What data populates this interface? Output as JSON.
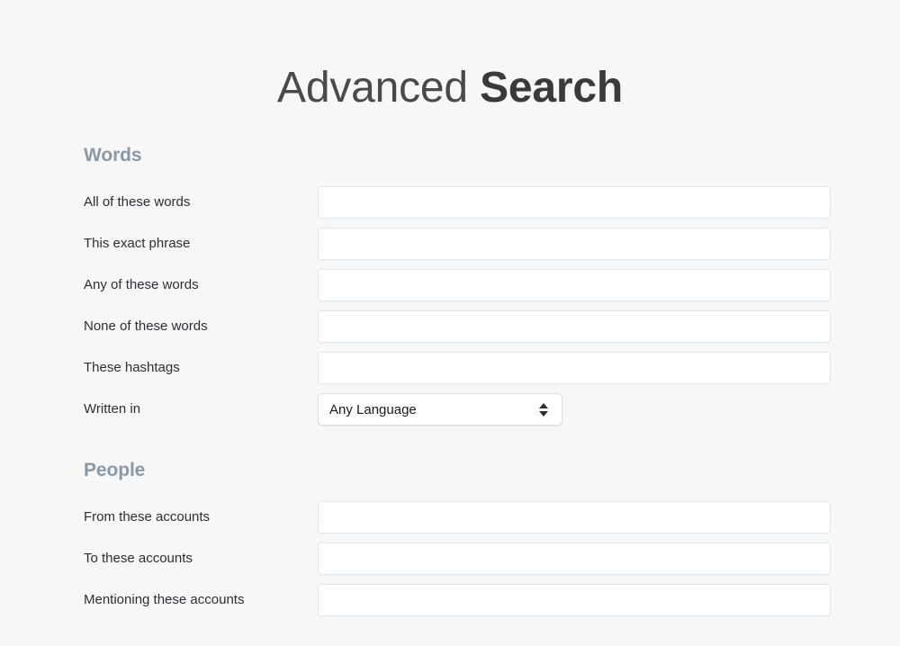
{
  "title": {
    "light": "Advanced ",
    "bold": "Search"
  },
  "sections": [
    {
      "id": "words",
      "header": "Words",
      "fields": [
        {
          "id": "all-of-these-words",
          "label": "All of these words",
          "type": "text",
          "value": "",
          "placeholder": ""
        },
        {
          "id": "this-exact-phrase",
          "label": "This exact phrase",
          "type": "text",
          "value": "",
          "placeholder": ""
        },
        {
          "id": "any-of-these-words",
          "label": "Any of these words",
          "type": "text",
          "value": "",
          "placeholder": ""
        },
        {
          "id": "none-of-these-words",
          "label": "None of these words",
          "type": "text",
          "value": "",
          "placeholder": ""
        },
        {
          "id": "these-hashtags",
          "label": "These hashtags",
          "type": "text",
          "value": "",
          "placeholder": ""
        },
        {
          "id": "written-in",
          "label": "Written in",
          "type": "select",
          "value": "Any Language",
          "icon": "stepper-updown-icon"
        }
      ]
    },
    {
      "id": "people",
      "header": "People",
      "fields": [
        {
          "id": "from-these-accounts",
          "label": "From these accounts",
          "type": "text",
          "value": "",
          "placeholder": ""
        },
        {
          "id": "to-these-accounts",
          "label": "To these accounts",
          "type": "text",
          "value": "",
          "placeholder": ""
        },
        {
          "id": "mentioning-these-accounts",
          "label": "Mentioning these accounts",
          "type": "text",
          "value": "",
          "placeholder": ""
        }
      ]
    }
  ],
  "colors": {
    "background": "#f7f7f7",
    "section_header": "#8b99a6",
    "label": "#2b2f33",
    "input_border": "#e1e8ed",
    "title": "#3b3b3b"
  }
}
